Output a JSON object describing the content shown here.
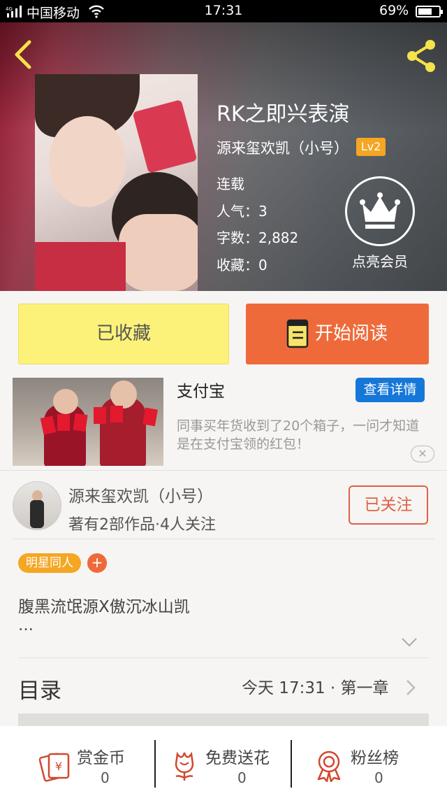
{
  "status_bar": {
    "carrier": "中国移动",
    "time": "17:31",
    "battery": "69%",
    "battery_level": 0.69
  },
  "book": {
    "title": "RK之即兴表演",
    "author": "源来玺欢凯（小号）",
    "level": "Lv2",
    "status": "连载",
    "popularity": "人气：3",
    "word_count": "字数：2,882",
    "favorites": "收藏：0",
    "member_label": "点亮会员"
  },
  "actions": {
    "collected": "已收藏",
    "start_reading": "开始阅读"
  },
  "ad": {
    "title": "支付宝",
    "detail_button": "查看详情",
    "description": "同事买年货收到了20个箱子，一问才知道是在支付宝领的红包！",
    "close": "✕"
  },
  "author_card": {
    "name": "源来玺欢凯（小号）",
    "stats": "著有2部作品·4人关注",
    "follow_button": "已关注"
  },
  "tags": {
    "items": [
      "明星同人"
    ],
    "add": "+"
  },
  "synopsis": {
    "text": "腹黑流氓源X傲沉冰山凯",
    "more": "…"
  },
  "toc": {
    "title": "目录",
    "latest": "今天 17:31 · 第一章"
  },
  "bottom_bar": [
    {
      "label": "赏金币",
      "count": "0",
      "icon": "red-envelope-icon"
    },
    {
      "label": "免费送花",
      "count": "0",
      "icon": "flower-icon"
    },
    {
      "label": "粉丝榜",
      "count": "0",
      "icon": "award-ribbon-icon"
    }
  ],
  "colors": {
    "accent_orange": "#ee6a3a",
    "collected_yellow": "#fcf27a",
    "badge_yellow": "#f5a623",
    "link_blue": "#1577d8",
    "icon_red": "#d3472e"
  }
}
